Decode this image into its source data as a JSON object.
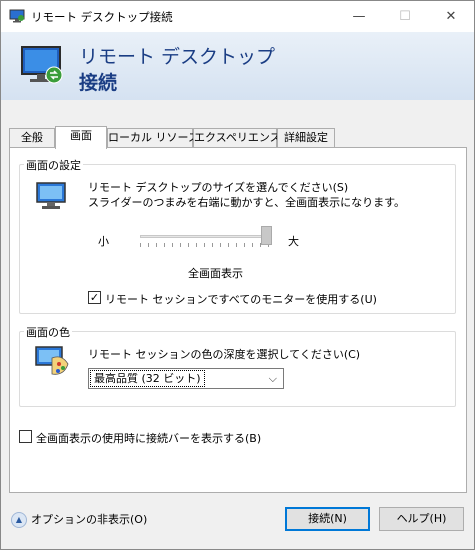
{
  "window": {
    "title": "リモート デスクトップ接続",
    "controls": {
      "minimize": "—",
      "maximize": "☐",
      "close": "✕"
    }
  },
  "banner": {
    "line1": "リモート デスクトップ",
    "line2": "接続"
  },
  "tabs": [
    {
      "label": "全般"
    },
    {
      "label": "画面"
    },
    {
      "label": "ローカル リソース"
    },
    {
      "label": "エクスペリエンス"
    },
    {
      "label": "詳細設定"
    }
  ],
  "display_settings": {
    "legend": "画面の設定",
    "description_line1": "リモート デスクトップのサイズを選んでください(S)",
    "description_line2": "スライダーのつまみを右端に動かすと、全画面表示になります。",
    "slider_min_label": "小",
    "slider_max_label": "大",
    "slider_value_label": "全画面表示",
    "slider_level": 1.0,
    "multimon_checkbox_label": "リモート セッションですべてのモニターを使用する(U)",
    "multimon_checked": true
  },
  "colors": {
    "legend": "画面の色",
    "description": "リモート セッションの色の深度を選択してください(C)",
    "selected_depth": "最高品質 (32 ビット)"
  },
  "connection_bar_checkbox_label": "全画面表示の使用時に接続バーを表示する(B)",
  "connection_bar_checked": false,
  "footer": {
    "options_toggle_label": "オプションの非表示(O)",
    "connect_button": "接続(N)",
    "help_button": "ヘルプ(H)"
  }
}
